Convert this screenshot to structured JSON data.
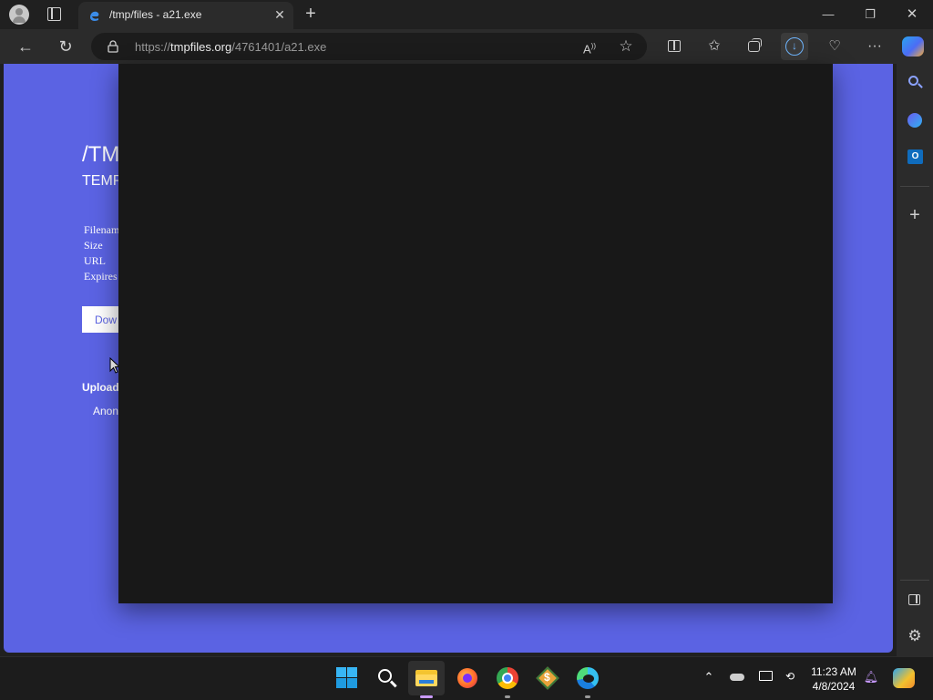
{
  "browser": {
    "tab_title": "/tmp/files - a21.exe",
    "url_prefix": "https://",
    "url_domain": "tmpfiles.org",
    "url_path": "/4761401/a21.exe"
  },
  "page": {
    "site_title": "/TM",
    "site_subtitle": "TEMP",
    "meta_labels": [
      "Filenam",
      "Size",
      "URL",
      "Expires"
    ],
    "download_label": "Dow",
    "upload_label": "Upload",
    "anon_label": "Anon",
    "bg_color": "#5b63e3"
  },
  "taskbar": {
    "time": "11:23 AM",
    "date": "4/8/2024"
  },
  "icons": {
    "tab": [
      "profile-icon",
      "tab-actions-icon",
      "edge-favicon",
      "close-tab-icon",
      "new-tab-icon"
    ],
    "window": [
      "minimize-icon",
      "restore-icon",
      "close-window-icon"
    ],
    "toolbar": [
      "back-icon",
      "refresh-icon",
      "lock-icon",
      "read-aloud-icon",
      "favorite-star-icon",
      "split-screen-icon",
      "favorites-icon",
      "collections-icon",
      "downloads-icon",
      "browser-essentials-icon",
      "more-icon",
      "copilot-icon"
    ],
    "sidebar": [
      "search-icon",
      "copilot-sidebar-icon",
      "outlook-icon",
      "add-icon",
      "sidebar-toggle-icon",
      "settings-icon"
    ],
    "taskbar": [
      "windows-start-icon",
      "search-icon",
      "file-explorer-icon",
      "firefox-icon",
      "chrome-icon",
      "app-icon",
      "edge-icon",
      "chevron-up-icon",
      "onedrive-icon",
      "display-icon",
      "network-icon",
      "notification-bell-icon",
      "copilot-taskbar-icon"
    ]
  }
}
